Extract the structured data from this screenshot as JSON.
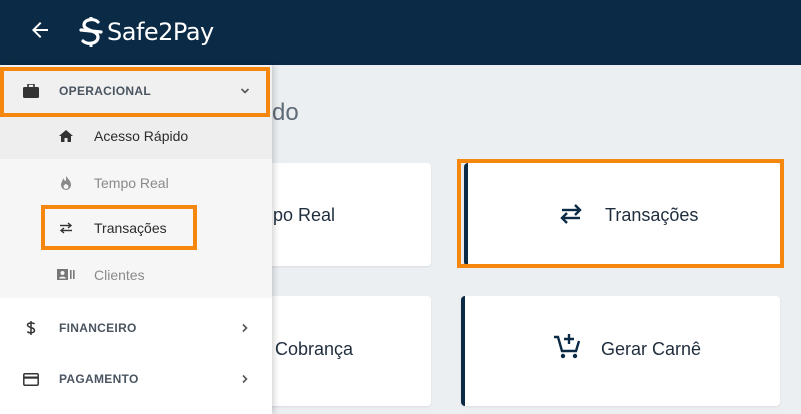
{
  "header": {
    "brand_name": "Safe2Pay",
    "brand_color": "#0b2a45",
    "back_icon": "arrow-left-icon",
    "logo_icon": "safe2pay-s-logo-icon"
  },
  "main": {
    "heading_fragment": "do",
    "cards": [
      {
        "label": "mpo Real",
        "icon": null
      },
      {
        "label": "Transações",
        "icon": "swap-arrows-icon"
      },
      {
        "label": "ar Cobrança",
        "icon": null
      },
      {
        "label": "Gerar Carnê",
        "icon": "cart-add-icon"
      }
    ]
  },
  "sidebar": {
    "groups": [
      {
        "label": "OPERACIONAL",
        "icon": "briefcase-icon",
        "expanded": true
      },
      {
        "label": "FINANCEIRO",
        "icon": "dollar-icon",
        "expanded": false
      },
      {
        "label": "PAGAMENTO",
        "icon": "credit-card-icon",
        "expanded": false
      }
    ],
    "subitems": [
      {
        "label": "Acesso Rápido",
        "icon": "home-icon",
        "active": true
      },
      {
        "label": "Tempo Real",
        "icon": "flame-icon",
        "active": false
      },
      {
        "label": "Transações",
        "icon": "swap-arrows-icon",
        "active": false
      },
      {
        "label": "Clientes",
        "icon": "contacts-card-icon",
        "active": false
      }
    ]
  },
  "colors": {
    "highlight": "#f5870f",
    "background": "#eceff2",
    "accent": "#0b2a45"
  }
}
